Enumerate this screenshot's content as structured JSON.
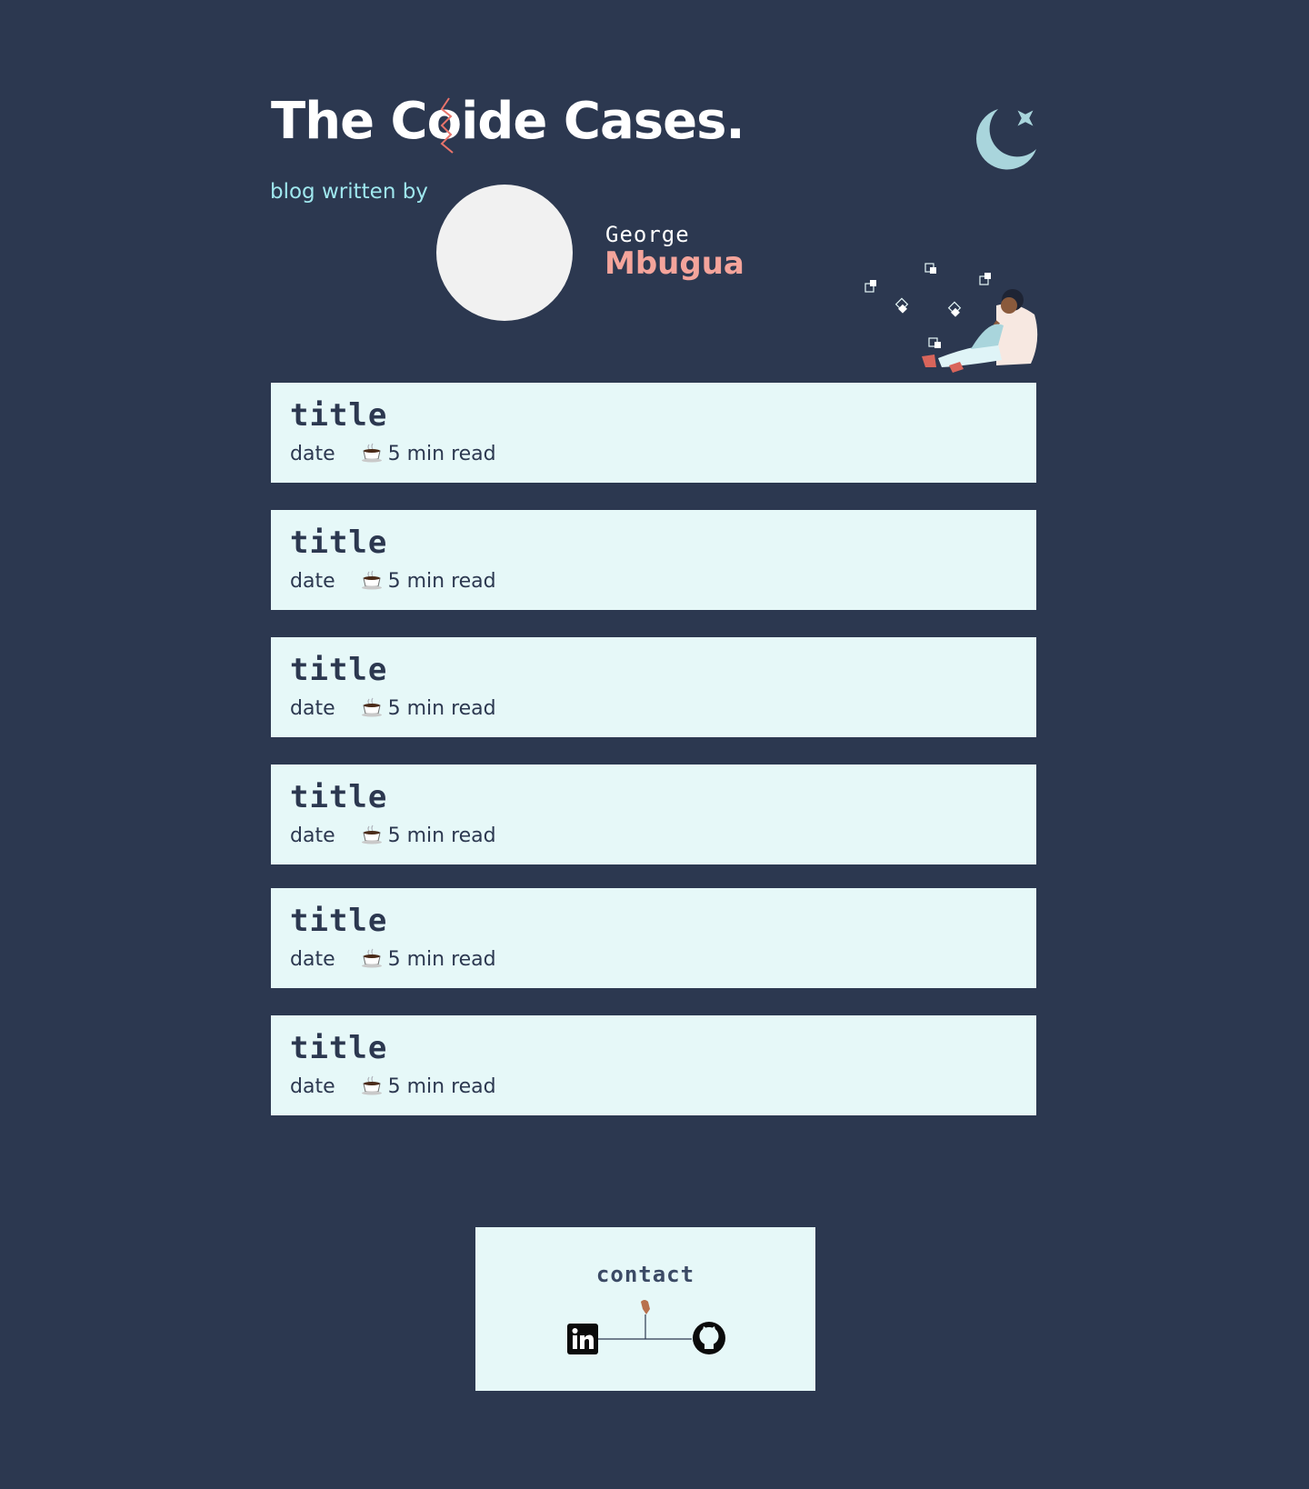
{
  "header": {
    "site_title": "The Coide Cases.",
    "tagline": "blog written by",
    "author_first_name": "George",
    "author_last_name": "Mbugua"
  },
  "icons": {
    "theme": "moon-star-icon",
    "read_time": "coffee-cup-icon",
    "linkedin": "linkedin-icon",
    "github": "github-icon"
  },
  "colors": {
    "background": "#2c3850",
    "card": "#e6f8f8",
    "accent_pink": "#f4a49b",
    "accent_cyan": "#9fe7ee",
    "moon": "#a9d5dc"
  },
  "posts": [
    {
      "title": "title",
      "date": "date",
      "read_time": "5 min read"
    },
    {
      "title": "title",
      "date": "date",
      "read_time": "5 min read"
    },
    {
      "title": "title",
      "date": "date",
      "read_time": "5 min read"
    },
    {
      "title": "title",
      "date": "date",
      "read_time": "5 min read"
    },
    {
      "title": "title",
      "date": "date",
      "read_time": "5 min read"
    },
    {
      "title": "title",
      "date": "date",
      "read_time": "5 min read"
    }
  ],
  "contact": {
    "heading": "contact"
  }
}
